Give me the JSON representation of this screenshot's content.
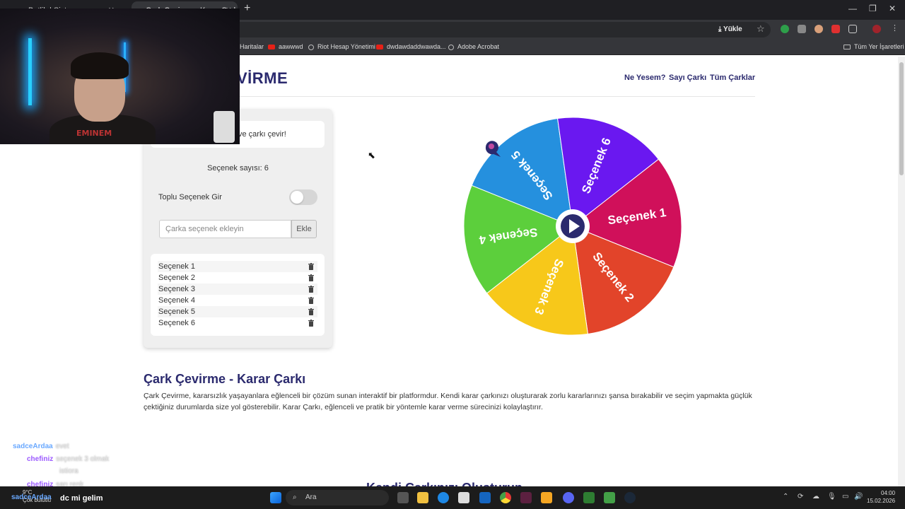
{
  "browser": {
    "tabs": [
      {
        "title": "Batlik | Sistem..."
      },
      {
        "title": "Çark Çevirme - Karar Çarkı"
      }
    ],
    "install_label": "Yükle",
    "bookmarks": [
      "Haritalar",
      "aawwwd",
      "Riot Hesap Yönetimi",
      "dwdawdaddwawda...",
      "Adobe Acrobat"
    ],
    "all_bookmarks": "Tüm Yer İşaretleri"
  },
  "site": {
    "logo": "VİRME",
    "nav": [
      "Ne Yesem?",
      "Sayı Çarkı",
      "Tüm Çarklar"
    ]
  },
  "panel": {
    "info_text": "ve çarkı çevir!",
    "count_text": "Seçenek sayısı: 6",
    "bulk_label": "Toplu Seçenek Gir",
    "bulk_enabled": false,
    "input_placeholder": "Çarka seçenek ekleyin",
    "add_button": "Ekle",
    "options": [
      "Seçenek 1",
      "Seçenek 2",
      "Seçenek 3",
      "Seçenek 4",
      "Seçenek 5",
      "Seçenek 6"
    ]
  },
  "wheel": {
    "segments": [
      {
        "label": "Seçenek 1",
        "color": "#d0105a"
      },
      {
        "label": "Seçenek 2",
        "color": "#e2442a"
      },
      {
        "label": "Seçenek 3",
        "color": "#f7c81a"
      },
      {
        "label": "Seçenek 4",
        "color": "#5ccf3c"
      },
      {
        "label": "Seçenek 5",
        "color": "#2590de"
      },
      {
        "label": "Seçenek 6",
        "color": "#6a18f0"
      }
    ],
    "center_color": "#2b2a6e"
  },
  "content": {
    "heading": "Çark Çevirme - Karar Çarkı",
    "paragraph": "Çark Çevirme, kararsızlık yaşayanlara eğlenceli bir çözüm sunan interaktif bir platformdur. Kendi karar çarkınızı oluşturarak zorlu kararlarınızı şansa bırakabilir ve seçim yapmakta güçlük çektiğiniz durumlarda size yol gösterebilir. Karar Çarkı, eğlenceli ve pratik bir yöntemle karar verme sürecinizi kolaylaştırır.",
    "heading2": "Kendi Çarkınızı Oluşturun"
  },
  "stream": {
    "shirt_text": "EMINEM",
    "chat": [
      {
        "user": "sadceArdaa",
        "msg": "evet"
      },
      {
        "user": "chefiniz",
        "msg": "seçenek 3 olmak"
      },
      {
        "user": "",
        "msg": "istiora"
      },
      {
        "user": "chefiniz",
        "msg": "sarı renk"
      },
      {
        "user": "sadceArdaa",
        "msg": "dc mi gelim"
      }
    ]
  },
  "taskbar": {
    "search_placeholder": "Ara",
    "weather_temp": "9°C",
    "weather_desc": "Çok bulutlu",
    "time": "04:00",
    "date": "15.02.2026"
  }
}
